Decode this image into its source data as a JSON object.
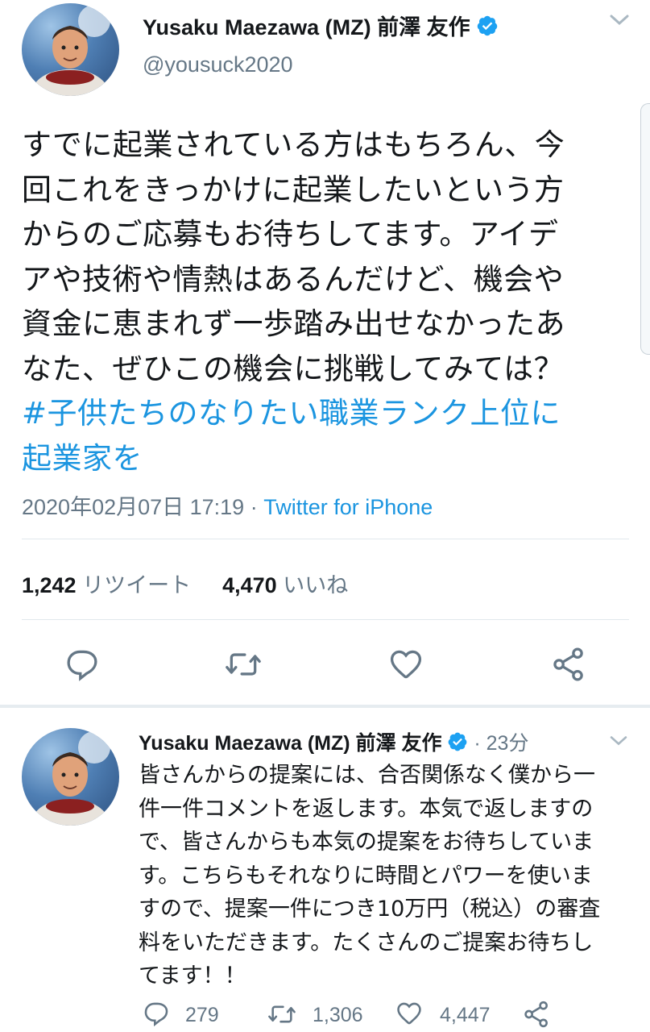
{
  "main_tweet": {
    "display_name": "Yusaku Maezawa (MZ) 前澤 友作",
    "handle": "@yousuck2020",
    "text_lines": [
      "すでに起業されている方はもちろん、今",
      "回これをきっかけに起業したいという方",
      "からのご応募もお待ちしてます。アイデ",
      "アや技術や情熱はあるんだけど、機会や",
      "資金に恵まれず一歩踏み出せなかったあ",
      "なた、ぜひこの機会に挑戦してみては？"
    ],
    "hashtag_lines": [
      "#子供たちのなりたい職業ランク上位に",
      "起業家を"
    ],
    "timestamp": "2020年02月07日 17:19",
    "separator": " · ",
    "source": "Twitter for iPhone",
    "retweets_count": "1,242",
    "retweets_label": "リツイート",
    "likes_count": "4,470",
    "likes_label": "いいね"
  },
  "reply_tweet": {
    "display_name": "Yusaku Maezawa (MZ) 前澤 友作",
    "time": "· 23分",
    "text_lines": [
      "皆さんからの提案には、合否関係なく僕から一",
      "件一件コメントを返します。本気で返しますの",
      "で、皆さんからも本気の提案をお待ちしていま",
      "す。こちらもそれなりに時間とパワーを使いま",
      "すので、提案一件につき10万円（税込）の審査",
      "料をいただきます。たくさんのご提案お待ちし",
      "てます！！"
    ],
    "reply_count": "279",
    "retweet_count": "1,306",
    "like_count": "4,447"
  },
  "icons": {
    "verified": "verified-badge-icon",
    "chevron": "chevron-down-icon",
    "reply": "reply-icon",
    "retweet": "retweet-icon",
    "like": "heart-icon",
    "share": "share-icon"
  },
  "colors": {
    "link": "#1b95e0",
    "secondary": "#657786",
    "divider": "#e1e8ed",
    "verified": "#1da1f2"
  }
}
